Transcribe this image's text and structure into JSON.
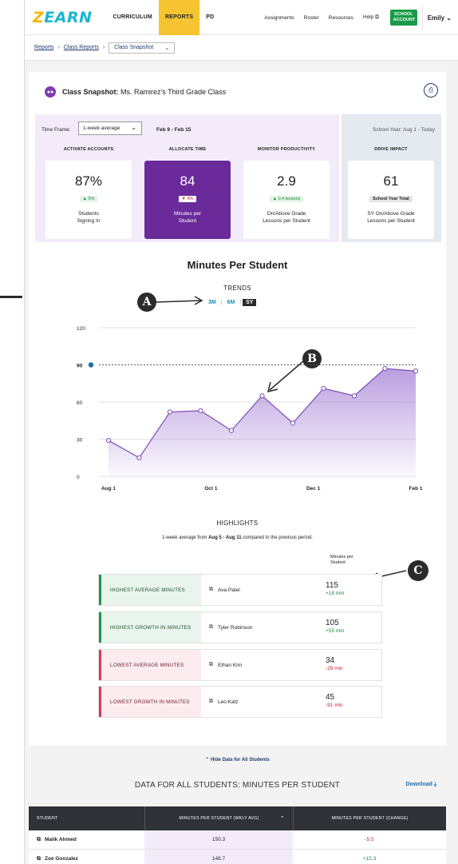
{
  "nav": {
    "logo": "ZEARN",
    "links": [
      "CURRICULUM",
      "REPORTS",
      "PD"
    ],
    "right_links": [
      "Assignments",
      "Roster",
      "Resources",
      "Help"
    ],
    "school_account": "SCHOOL ACCOUNT",
    "user": "Emily"
  },
  "breadcrumb": {
    "items": [
      "Reports",
      "Class Reports"
    ],
    "current": "Class Snapshot"
  },
  "header": {
    "label": "Class Snapshot:",
    "class_name": "Ms. Ramirez's Third Grade Class"
  },
  "timeframe": {
    "label": "Time Frame:",
    "value": "1-week average",
    "range": "Feb 9 - Feb 15"
  },
  "school_year": {
    "label": "School Year:",
    "value": "Aug 1 - Today"
  },
  "columns": [
    "ACTIVATE ACCOUNTS",
    "ALLOCATE TIME",
    "MONITOR PRODUCTIVITY",
    "DRIVE IMPACT"
  ],
  "metrics": [
    {
      "value": "87%",
      "delta": "▲ 5%",
      "label1": "Students",
      "label2": "Signing In"
    },
    {
      "value": "84",
      "delta": "▼ 9%",
      "label1": "Minutes per",
      "label2": "Student"
    },
    {
      "value": "2.9",
      "delta": "▲ 0.4 lessons",
      "label1": "On/Above Grade",
      "label2": "Lessons per Student"
    },
    {
      "value": "61",
      "delta": "School Year Total",
      "label1": "SY On/Above Grade",
      "label2": "Lessons per Student"
    }
  ],
  "chart": {
    "title": "Minutes Per Student",
    "trends_label": "TRENDS",
    "ranges": [
      "3M",
      "6M",
      "SY"
    ],
    "selected_range": "SY",
    "markers": [
      "A",
      "B",
      "C"
    ]
  },
  "chart_data": {
    "type": "area",
    "x_labels": [
      "Aug 1",
      "Oct 1",
      "Dec 1",
      "Feb 1"
    ],
    "y_ticks": [
      0,
      30,
      60,
      90,
      120
    ],
    "ylim": [
      0,
      120
    ],
    "target_line": 90,
    "values": [
      29,
      15,
      52,
      53,
      37,
      65,
      43,
      71,
      65,
      87,
      85
    ],
    "color": "#7d4ab8"
  },
  "highlights": {
    "title": "HIGHLIGHTS",
    "subtitle_pre": "1-week average from ",
    "subtitle_range": "Aug 5 - Aug 11",
    "subtitle_post": " compared to the previous period.",
    "col_head1": "Minutes per",
    "col_head2": "Student",
    "rows": [
      {
        "category": "HIGHEST AVERAGE MINUTES",
        "student": "Ava Patel",
        "value": "115",
        "delta": "+18 min"
      },
      {
        "category": "HIGHEST GROWTH IN MINUTES",
        "student": "Tyler Robinson",
        "value": "105",
        "delta": "+55 min"
      },
      {
        "category": "LOWEST AVERAGE MINUTES",
        "student": "Ethan Kim",
        "value": "34",
        "delta": "-29 min"
      },
      {
        "category": "LOWEST GROWTH IN MINUTES",
        "student": "Leo Katz",
        "value": "45",
        "delta": "-91 min"
      }
    ]
  },
  "table": {
    "hide_link": "Hide Data for All Students",
    "title": "DATA FOR ALL STUDENTS: MINUTES PER STUDENT",
    "download": "Download",
    "headers": [
      "STUDENT",
      "MINUTES PER STUDENT (WKLY AVG)",
      "MINUTES PER STUDENT (CHANGE)"
    ],
    "rows": [
      {
        "student": "Malik Ahmed",
        "avg": "150.3",
        "change": "-5.5"
      },
      {
        "student": "Zoe Gonzalez",
        "avg": "148.7",
        "change": "+15.3"
      }
    ]
  }
}
